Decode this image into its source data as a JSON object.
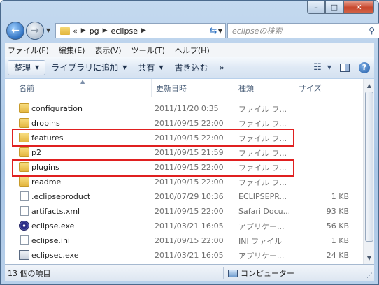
{
  "caption": {
    "minimize": "–",
    "maximize": "□",
    "close": "✕"
  },
  "nav": {
    "back_icon": "back-arrow-icon",
    "forward_icon": "forward-arrow-icon",
    "address": {
      "overflow": "«",
      "crumbs": [
        "pg",
        "eclipse"
      ]
    },
    "search_placeholder": "eclipseの検索"
  },
  "menu": [
    "ファイル(F)",
    "編集(E)",
    "表示(V)",
    "ツール(T)",
    "ヘルプ(H)"
  ],
  "toolbar": {
    "organize": "整理",
    "library": "ライブラリに追加",
    "share": "共有",
    "burn": "書き込む",
    "more": "»"
  },
  "columns": {
    "name": "名前",
    "date": "更新日時",
    "type": "種類",
    "size": "サイズ"
  },
  "files": [
    {
      "name": "configuration",
      "date": "2011/11/20 0:35",
      "type": "ファイル フ...",
      "size": "",
      "icon": "folder"
    },
    {
      "name": "dropins",
      "date": "2011/09/15 22:00",
      "type": "ファイル フ...",
      "size": "",
      "icon": "folder"
    },
    {
      "name": "features",
      "date": "2011/09/15 22:00",
      "type": "ファイル フ...",
      "size": "",
      "icon": "folder"
    },
    {
      "name": "p2",
      "date": "2011/09/15 21:59",
      "type": "ファイル フ...",
      "size": "",
      "icon": "folder"
    },
    {
      "name": "plugins",
      "date": "2011/09/15 22:00",
      "type": "ファイル フ...",
      "size": "",
      "icon": "folder"
    },
    {
      "name": "readme",
      "date": "2011/09/15 22:00",
      "type": "ファイル フ...",
      "size": "",
      "icon": "folder"
    },
    {
      "name": ".eclipseproduct",
      "date": "2010/07/29 10:36",
      "type": "ECLIPSEPR...",
      "size": "1 KB",
      "icon": "file"
    },
    {
      "name": "artifacts.xml",
      "date": "2011/09/15 22:00",
      "type": "Safari Docu...",
      "size": "93 KB",
      "icon": "xml"
    },
    {
      "name": "eclipse.exe",
      "date": "2011/03/21 16:05",
      "type": "アプリケー...",
      "size": "56 KB",
      "icon": "exe"
    },
    {
      "name": "eclipse.ini",
      "date": "2011/09/15 22:00",
      "type": "INI ファイル",
      "size": "1 KB",
      "icon": "ini"
    },
    {
      "name": "eclipsec.exe",
      "date": "2011/03/21 16:05",
      "type": "アプリケー...",
      "size": "24 KB",
      "icon": "exec"
    }
  ],
  "status": {
    "count": "13 個の項目",
    "zone": "コンピューター"
  }
}
